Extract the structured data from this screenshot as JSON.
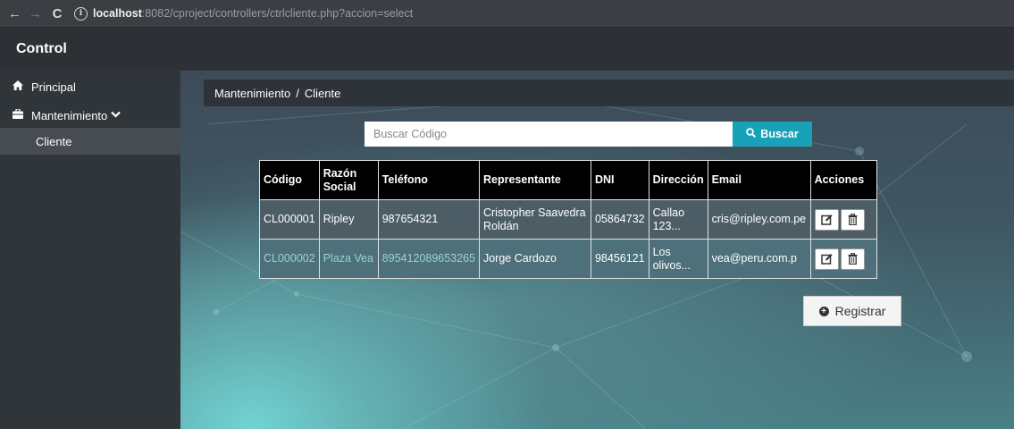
{
  "browser": {
    "url_host": "localhost",
    "url_rest": ":8082/cproject/controllers/ctrlcliente.php?accion=select"
  },
  "app": {
    "brand": "Control"
  },
  "sidebar": {
    "items": [
      {
        "label": "Principal",
        "icon": "home-icon"
      },
      {
        "label": "Mantenimiento",
        "icon": "briefcase-icon"
      },
      {
        "label": "Cliente"
      }
    ]
  },
  "breadcrumb": {
    "parent": "Mantenimiento",
    "separator": "/",
    "current": "Cliente"
  },
  "search": {
    "placeholder": "Buscar Código",
    "button_label": "Buscar"
  },
  "table": {
    "headers": [
      "Código",
      "Razón Social",
      "Teléfono",
      "Representante",
      "DNI",
      "Dirección",
      "Email",
      "Acciones"
    ],
    "rows": [
      [
        "CL000001",
        "Ripley",
        "987654321",
        "Cristopher Saavedra Roldán",
        "05864732",
        "Callao 123...",
        "cris@ripley.com.pe"
      ],
      [
        "CL000002",
        "Plaza Vea",
        "895412089653265",
        "Jorge Cardozo",
        "98456121",
        "Los olivos...",
        "vea@peru.com.p"
      ]
    ]
  },
  "register": {
    "label": "Registrar"
  },
  "colors": {
    "accent": "#17a2b8",
    "sidebar": "#30353a",
    "header": "#000000"
  }
}
